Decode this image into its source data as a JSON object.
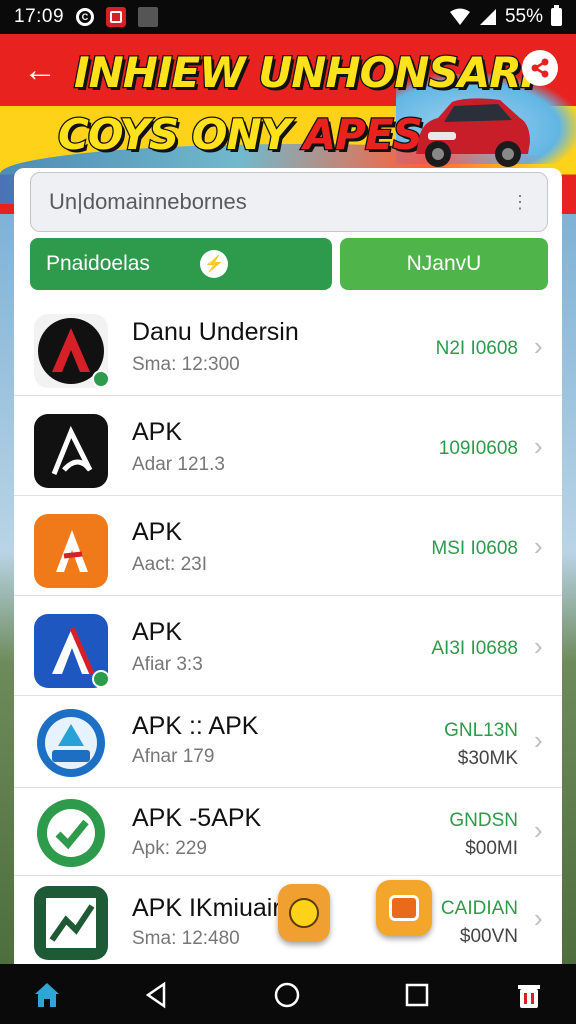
{
  "status_bar": {
    "time": "17:09",
    "battery": "55%",
    "icons": [
      "c-icon",
      "red-app-icon",
      "image-icon",
      "wifi-icon",
      "signal-icon",
      "battery-icon"
    ]
  },
  "banner": {
    "title_line1": "INHIEW UNHONSARI",
    "title_line2_a": "COYS ONY ",
    "title_line2_b": "APES"
  },
  "search": {
    "value": "Un|domainnebornes"
  },
  "buttons": {
    "primary_label": "Pnaidoelas",
    "secondary_label": "NJanvU"
  },
  "apps": [
    {
      "name": "Danu Undersin",
      "sub": "Sma: 12:300",
      "size": "N2I I0608",
      "icon": "red-a-icon"
    },
    {
      "name": "APK",
      "sub": "Adar 121.3",
      "size": "109I0608",
      "icon": "black-a-icon"
    },
    {
      "name": "APK",
      "sub": "Aact: 23I",
      "size": "MSI I0608",
      "icon": "orange-a-icon"
    },
    {
      "name": "APK",
      "sub": "Afiar 3:3",
      "size": "AI3I I0688",
      "icon": "blue-a-icon"
    },
    {
      "name": "APK :: APK",
      "sub": "Afnar 179",
      "size": "GNL13N",
      "size2": "$30MK",
      "icon": "badge-icon"
    },
    {
      "name": "APK -5APK",
      "sub": "Apk: 229",
      "size": "GNDSN",
      "size2": "$00MI",
      "icon": "check-icon"
    },
    {
      "name": "APK IKmiuair",
      "sub": "Sma: 12:480",
      "size": "CAIDIAN",
      "size2": "$00VN",
      "icon": "green-chart-icon"
    }
  ],
  "colors": {
    "green": "#2e9a4b",
    "light_green": "#4fb54b",
    "red": "#e8231f",
    "yellow": "#ffe21a"
  }
}
